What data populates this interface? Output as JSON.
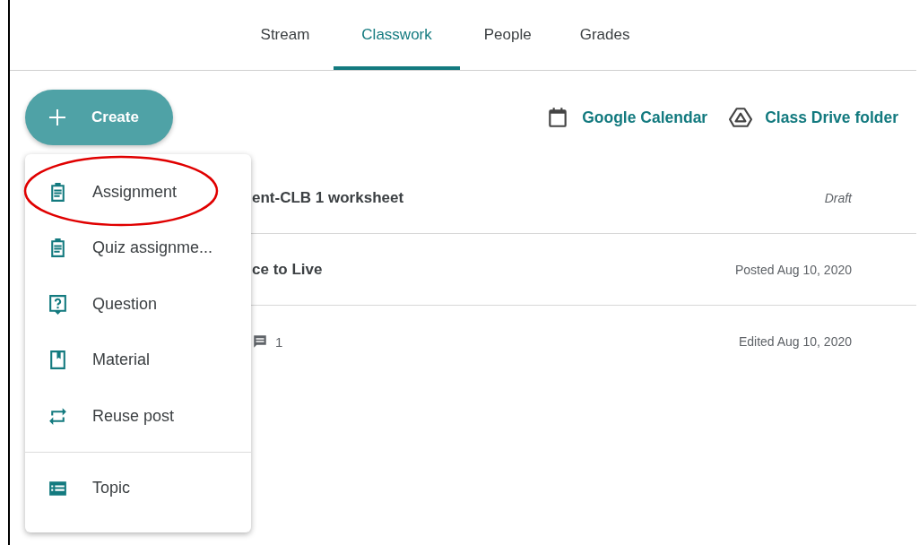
{
  "tabs": [
    {
      "label": "Stream",
      "selected": false
    },
    {
      "label": "Classwork",
      "selected": true
    },
    {
      "label": "People",
      "selected": false
    },
    {
      "label": "Grades",
      "selected": false
    }
  ],
  "create_button": {
    "label": "Create"
  },
  "links": [
    {
      "kind": "calendar",
      "label": "Google Calendar"
    },
    {
      "kind": "drive",
      "label": "Class Drive folder"
    }
  ],
  "posts": [
    {
      "title": "ent-CLB 1 worksheet",
      "status": "Draft",
      "draft": true
    },
    {
      "title": "ce to Live",
      "status": "Posted Aug 10, 2020",
      "draft": false
    },
    {
      "comments": "1",
      "status": "Edited Aug 10, 2020",
      "draft": false
    }
  ],
  "create_menu": [
    {
      "kind": "assignment",
      "label": "Assignment",
      "highlighted": true
    },
    {
      "kind": "quiz",
      "label": "Quiz assignme...",
      "highlighted": false
    },
    {
      "kind": "question",
      "label": "Question",
      "highlighted": false
    },
    {
      "kind": "material",
      "label": "Material",
      "highlighted": false
    },
    {
      "kind": "reuse",
      "label": "Reuse post",
      "highlighted": false
    },
    {
      "kind": "topic",
      "label": "Topic",
      "highlighted": false
    }
  ]
}
